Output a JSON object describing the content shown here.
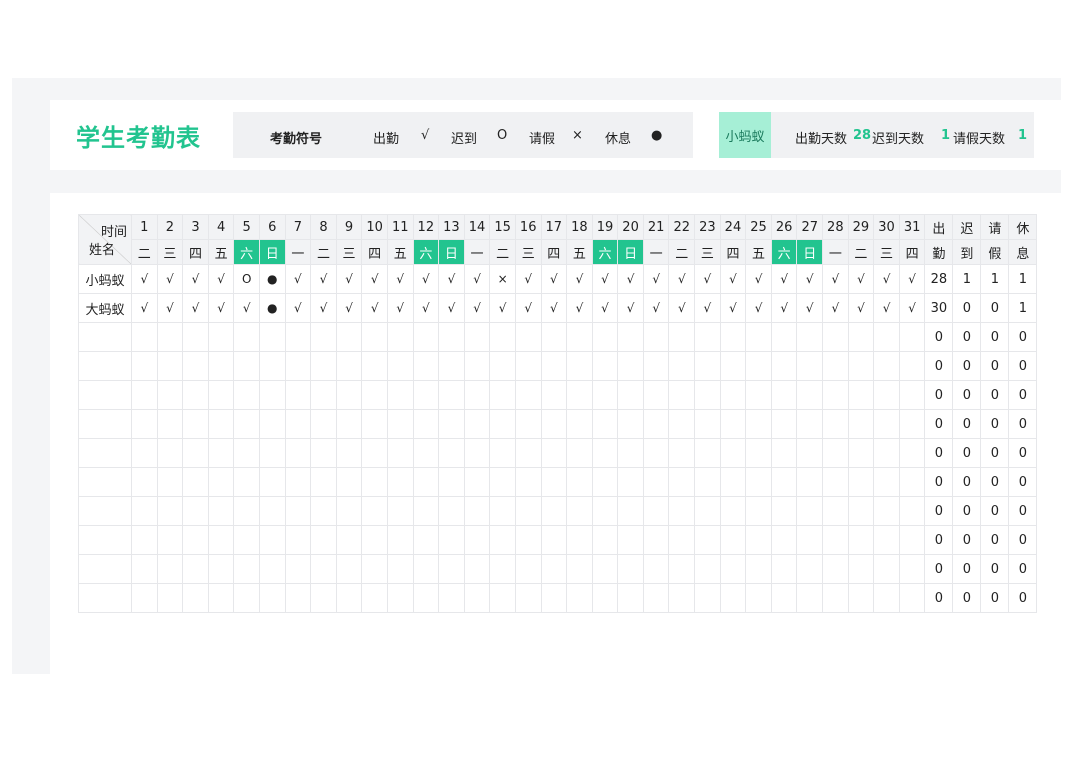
{
  "title": "学生考勤表",
  "legend": {
    "label": "考勤符号",
    "items": [
      {
        "name": "出勤",
        "symbol": "√"
      },
      {
        "name": "迟到",
        "symbol": "O"
      },
      {
        "name": "请假",
        "symbol": "×"
      },
      {
        "name": "休息",
        "symbol": "●"
      }
    ]
  },
  "summary": {
    "student": "小蚂蚁",
    "attend_label": "出勤天数",
    "attend_value": "28",
    "late_label": "迟到天数",
    "late_value": "1",
    "leave_label": "请假天数",
    "leave_value": "1"
  },
  "table": {
    "corner_top": "时间",
    "corner_bottom": "姓名",
    "days": [
      "1",
      "2",
      "3",
      "4",
      "5",
      "6",
      "7",
      "8",
      "9",
      "10",
      "11",
      "12",
      "13",
      "14",
      "15",
      "16",
      "17",
      "18",
      "19",
      "20",
      "21",
      "22",
      "23",
      "24",
      "25",
      "26",
      "27",
      "28",
      "29",
      "30",
      "31"
    ],
    "weekdays": [
      "二",
      "三",
      "四",
      "五",
      "六",
      "日",
      "一",
      "二",
      "三",
      "四",
      "五",
      "六",
      "日",
      "一",
      "二",
      "三",
      "四",
      "五",
      "六",
      "日",
      "一",
      "二",
      "三",
      "四",
      "五",
      "六",
      "日",
      "一",
      "二",
      "三",
      "四"
    ],
    "weekend_color": "#22c48f",
    "stat_headers_top": [
      "出",
      "迟",
      "请",
      "休"
    ],
    "stat_headers_bottom": [
      "勤",
      "到",
      "假",
      "息"
    ],
    "rows": [
      {
        "name": "小蚂蚁",
        "marks": [
          "√",
          "√",
          "√",
          "√",
          "O",
          "●",
          "√",
          "√",
          "√",
          "√",
          "√",
          "√",
          "√",
          "√",
          "×",
          "√",
          "√",
          "√",
          "√",
          "√",
          "√",
          "√",
          "√",
          "√",
          "√",
          "√",
          "√",
          "√",
          "√",
          "√",
          "√"
        ],
        "stats": [
          "28",
          "1",
          "1",
          "1"
        ]
      },
      {
        "name": "大蚂蚁",
        "marks": [
          "√",
          "√",
          "√",
          "√",
          "√",
          "●",
          "√",
          "√",
          "√",
          "√",
          "√",
          "√",
          "√",
          "√",
          "√",
          "√",
          "√",
          "√",
          "√",
          "√",
          "√",
          "√",
          "√",
          "√",
          "√",
          "√",
          "√",
          "√",
          "√",
          "√",
          "√"
        ],
        "stats": [
          "30",
          "0",
          "0",
          "1"
        ]
      },
      {
        "name": "",
        "marks": [],
        "stats": [
          "0",
          "0",
          "0",
          "0"
        ]
      },
      {
        "name": "",
        "marks": [],
        "stats": [
          "0",
          "0",
          "0",
          "0"
        ]
      },
      {
        "name": "",
        "marks": [],
        "stats": [
          "0",
          "0",
          "0",
          "0"
        ]
      },
      {
        "name": "",
        "marks": [],
        "stats": [
          "0",
          "0",
          "0",
          "0"
        ]
      },
      {
        "name": "",
        "marks": [],
        "stats": [
          "0",
          "0",
          "0",
          "0"
        ]
      },
      {
        "name": "",
        "marks": [],
        "stats": [
          "0",
          "0",
          "0",
          "0"
        ]
      },
      {
        "name": "",
        "marks": [],
        "stats": [
          "0",
          "0",
          "0",
          "0"
        ]
      },
      {
        "name": "",
        "marks": [],
        "stats": [
          "0",
          "0",
          "0",
          "0"
        ]
      },
      {
        "name": "",
        "marks": [],
        "stats": [
          "0",
          "0",
          "0",
          "0"
        ]
      },
      {
        "name": "",
        "marks": [],
        "stats": [
          "0",
          "0",
          "0",
          "0"
        ]
      }
    ]
  }
}
